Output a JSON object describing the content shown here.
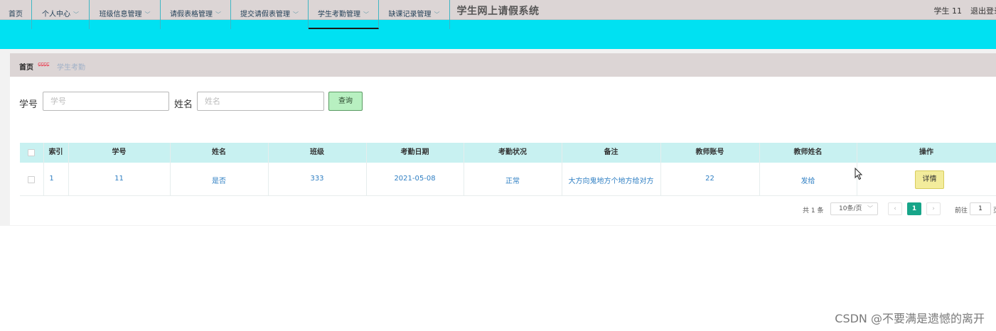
{
  "header": {
    "title": "学生网上请假系统",
    "user": "学生 11",
    "logout": "退出登录"
  },
  "nav": {
    "items": [
      {
        "label": "首页"
      },
      {
        "label": "个人中心"
      },
      {
        "label": "班级信息管理"
      },
      {
        "label": "请假表格管理"
      },
      {
        "label": "提交请假表管理"
      },
      {
        "label": "学生考勤管理"
      },
      {
        "label": "缺课记录管理"
      }
    ],
    "active": "学生考勤管理"
  },
  "breadcrumb": {
    "home": "首页",
    "separator": "ɕɕɕɕ",
    "current": "学生考勤"
  },
  "search": {
    "student_id_label": "学号",
    "student_id_placeholder": "学号",
    "name_label": "姓名",
    "name_placeholder": "姓名",
    "query_button": "查询"
  },
  "table": {
    "columns": [
      "索引",
      "学号",
      "姓名",
      "班级",
      "考勤日期",
      "考勤状况",
      "备注",
      "教师账号",
      "教师姓名",
      "操作"
    ],
    "rows": [
      {
        "index": "1",
        "student_id": "11",
        "name": "是否",
        "class": "333",
        "date": "2021-05-08",
        "status": "正常",
        "remark": "大方向鬼地方个地方给对方",
        "teacher_account": "22",
        "teacher_name": "发给",
        "action": "详情"
      }
    ]
  },
  "pagination": {
    "total": "共 1 条",
    "page_size": "10条/页",
    "prev": "‹",
    "current": "1",
    "next": "›",
    "goto_label": "前往",
    "goto_value": "1",
    "goto_suffix": "页"
  },
  "watermark": "CSDN @不要满是遗憾的离开",
  "colors": {
    "nav_bg": "#00e1f2",
    "header_bg": "#dcd5d5",
    "table_header_bg": "#c8f1f1",
    "query_button_bg": "#b8f0c1",
    "detail_button_bg": "#f3ec9c",
    "pagination_active": "#17a589",
    "link_text": "#2f7fc3"
  },
  "icons": {
    "nav_dropdown": "chevron-down-icon",
    "cursor": "mouse-pointer-icon"
  }
}
